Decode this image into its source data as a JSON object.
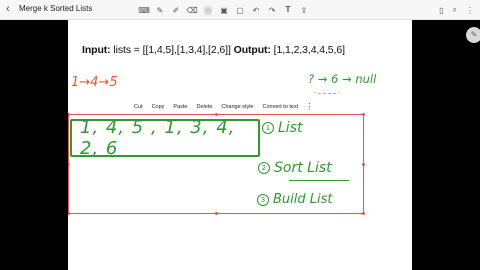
{
  "app": {
    "back_icon": "chevron-left-icon",
    "title": "Merge k Sorted Lists"
  },
  "toolbar": {
    "tools": [
      {
        "name": "tool-keyboard",
        "icon": "keyboard-icon",
        "glyph": "⌨"
      },
      {
        "name": "tool-pen",
        "icon": "pen-icon",
        "glyph": "✎"
      },
      {
        "name": "tool-marker",
        "icon": "marker-icon",
        "glyph": "✐"
      },
      {
        "name": "tool-eraser",
        "icon": "eraser-icon",
        "glyph": "⌫"
      },
      {
        "name": "tool-lasso",
        "icon": "lasso-icon",
        "glyph": "◌"
      },
      {
        "name": "tool-image",
        "icon": "image-icon",
        "glyph": "▣"
      },
      {
        "name": "tool-shape",
        "icon": "shape-icon",
        "glyph": "▢"
      },
      {
        "name": "tool-undo",
        "icon": "undo-icon",
        "glyph": "↶"
      },
      {
        "name": "tool-redo",
        "icon": "redo-icon",
        "glyph": "↷"
      },
      {
        "name": "tool-text",
        "icon": "text-icon",
        "glyph": "𝐓"
      },
      {
        "name": "tool-share",
        "icon": "share-icon",
        "glyph": "⇪"
      }
    ],
    "active_tool": "tool-lasso",
    "right": [
      {
        "name": "book-icon",
        "glyph": "▯"
      },
      {
        "name": "search-icon",
        "glyph": "⌕"
      },
      {
        "name": "more-icon",
        "glyph": "⋮"
      }
    ]
  },
  "page": {
    "problem_label": "Input:",
    "problem_input": " lists = [[1,4,5],[1,3,4],[2,6]] ",
    "problem_output_label": "Output:",
    "problem_output": " [1,1,2,3,4,4,5,6]",
    "hand_left": "1→4→5",
    "hand_right": "? → 6 → null",
    "green_sequence": "1, 4, 5 , 1, 3, 4, 2, 6",
    "steps": [
      {
        "num": "1",
        "text": "List"
      },
      {
        "num": "2",
        "text": "Sort List"
      },
      {
        "num": "3",
        "text": "Build List"
      }
    ]
  },
  "context_menu": {
    "items": [
      "Cut",
      "Copy",
      "Paste",
      "Delete",
      "Change style",
      "Convert to text"
    ],
    "more": "⋮"
  },
  "colors": {
    "ink_green": "#2f9a2f",
    "ink_orange": "#e05a2a",
    "selection_red": "#e45454"
  }
}
